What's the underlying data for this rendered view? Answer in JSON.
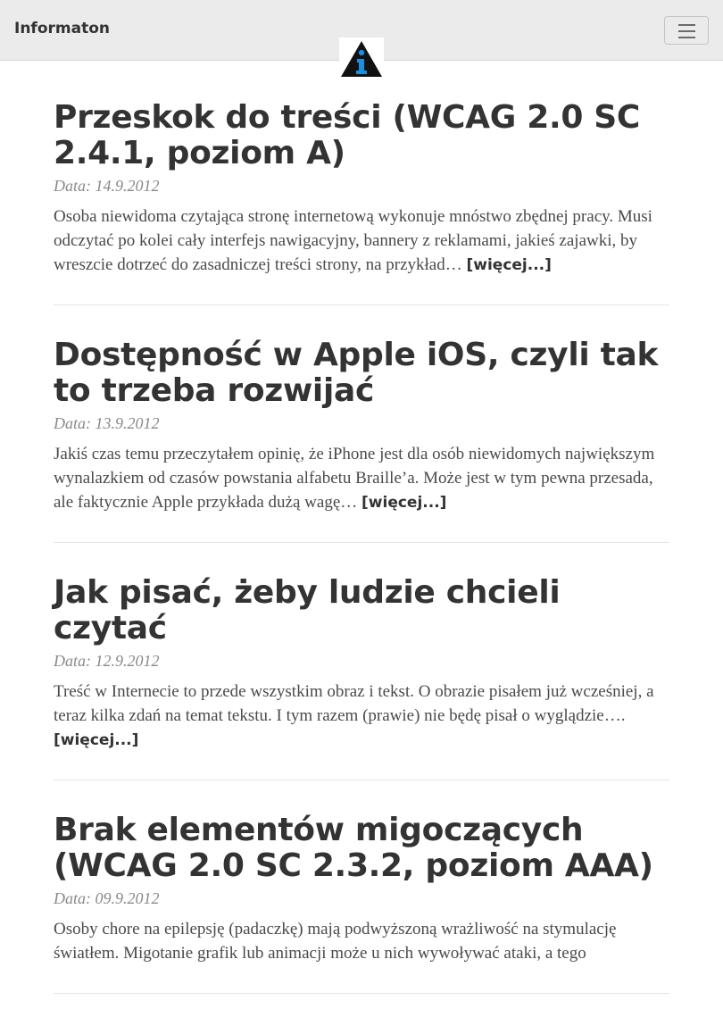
{
  "navbar": {
    "brand": "Informaton",
    "toggle_icon": "hamburger-menu-icon",
    "logo_icon": "info-triangle-logo-icon",
    "logo_colors": {
      "triangle": "#111111",
      "letter": "#1a8fe0"
    }
  },
  "posts": [
    {
      "title": "Przeskok do treści (WCAG 2.0 SC 2.4.1, poziom A)",
      "date": "Data: 14.9.2012",
      "excerpt": "Osoba niewidoma czytająca stronę internetową wykonuje mnóstwo zbędnej pracy. Musi odczytać po kolei cały interfejs nawigacyjny, bannery z reklamami, jakieś zajawki, by wreszcie dotrzeć do zasadniczej treści strony, na przykład… ",
      "more": "[więcej...]"
    },
    {
      "title": "Dostępność w Apple iOS, czyli tak to trzeba rozwijać",
      "date": "Data: 13.9.2012",
      "excerpt": "Jakiś czas temu przeczytałem opinię, że iPhone jest dla osób niewidomych największym wynalazkiem od czasów powstania alfabetu Braille’a. Może jest w tym pewna przesada, ale faktycznie Apple przykłada dużą wagę… ",
      "more": "[więcej...]"
    },
    {
      "title": "Jak pisać, żeby ludzie chcieli czytać",
      "date": "Data: 12.9.2012",
      "excerpt": "Treść w Internecie to przede wszystkim obraz i tekst. O obrazie pisałem już wcześniej, a teraz kilka zdań na temat tekstu. I tym razem (prawie) nie będę pisał o wyglądzie…. ",
      "more": "[więcej...]"
    },
    {
      "title": "Brak elementów migoczących (WCAG 2.0 SC 2.3.2, poziom AAA)",
      "date": "Data: 09.9.2012",
      "excerpt": "Osoby chore na epilepsję (padaczkę) mają podwyższoną wrażliwość na stymulację światłem. Migotanie grafik lub animacji może u nich wywoływać ataki, a tego",
      "more": ""
    }
  ]
}
